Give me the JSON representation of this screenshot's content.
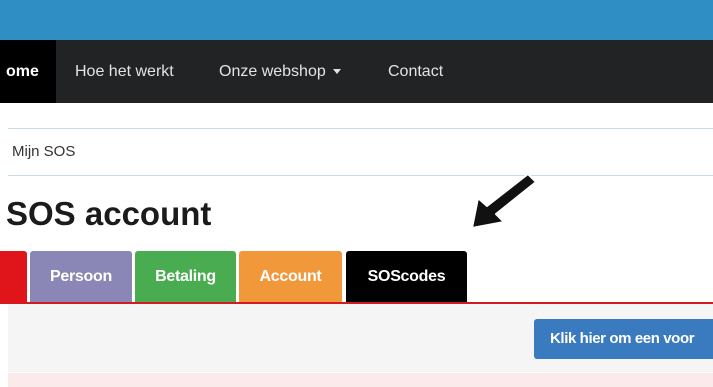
{
  "navbar": {
    "items": [
      {
        "label": "ome"
      },
      {
        "label": "Hoe het werkt"
      },
      {
        "label": "Onze webshop"
      },
      {
        "label": "Contact"
      }
    ]
  },
  "breadcrumb": {
    "current": "Mijn SOS"
  },
  "page": {
    "title": "SOS account"
  },
  "tabs": [
    {
      "label": "",
      "color": "#e0151b"
    },
    {
      "label": "Persoon",
      "color": "#8a86b6"
    },
    {
      "label": "Betaling",
      "color": "#4aac51"
    },
    {
      "label": "Account",
      "color": "#f1993a"
    },
    {
      "label": "SOScodes",
      "color": "#000000"
    }
  ],
  "panel": {
    "button_label": "Klik hier om een voor"
  },
  "colors": {
    "topbar": "#2f8ec3",
    "navbar": "#222324",
    "accent_line": "#d11b20",
    "button": "#3a7bbf"
  },
  "icons": {
    "pointer": "black-arrow-icon"
  }
}
